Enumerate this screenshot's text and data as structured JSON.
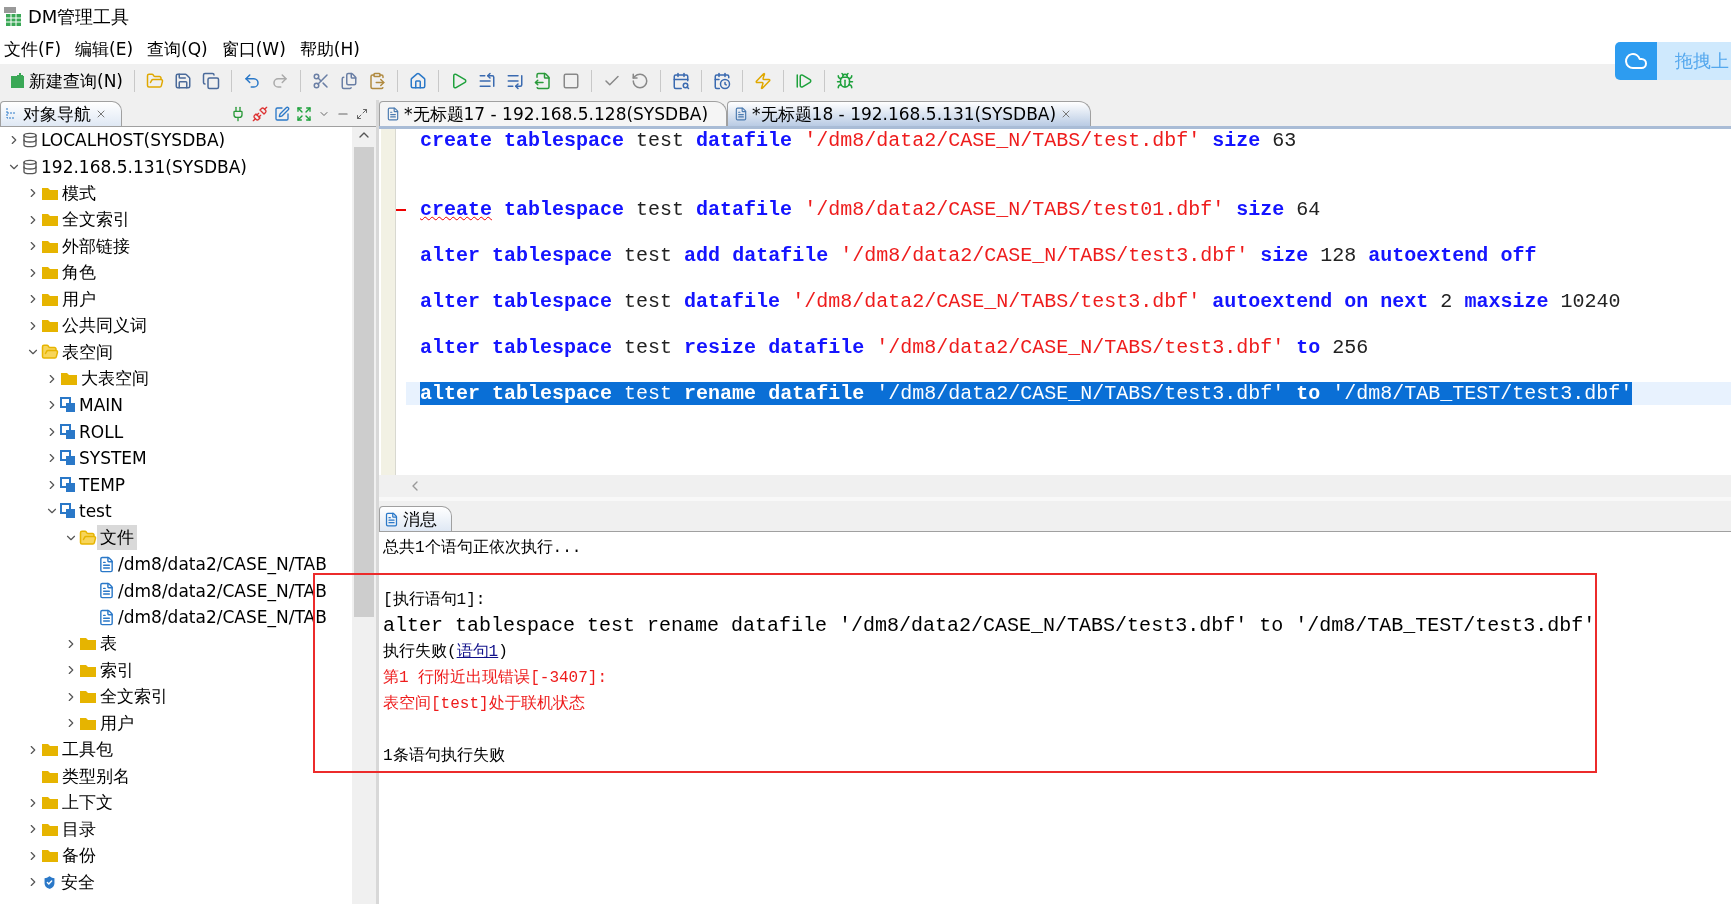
{
  "window": {
    "title": "DM管理工具"
  },
  "menu": [
    "文件(F)",
    "编辑(E)",
    "查询(Q)",
    "窗口(W)",
    "帮助(H)"
  ],
  "toolbar": {
    "new_query": "新建查询(N)"
  },
  "upload_widget": {
    "label": "拖拽上"
  },
  "navigator": {
    "title": "对象导航",
    "tree": [
      {
        "label": "LOCALHOST(SYSDBA)",
        "kind": "server",
        "expanded": false,
        "selected": false
      },
      {
        "label": "192.168.5.131(SYSDBA)",
        "kind": "server",
        "expanded": true,
        "selected": false,
        "children": [
          {
            "label": "模式",
            "kind": "folder",
            "expanded": false,
            "selected": false
          },
          {
            "label": "全文索引",
            "kind": "folder",
            "expanded": false,
            "selected": false
          },
          {
            "label": "外部链接",
            "kind": "folder",
            "expanded": false,
            "selected": false
          },
          {
            "label": "角色",
            "kind": "folder",
            "expanded": false,
            "selected": false
          },
          {
            "label": "用户",
            "kind": "folder",
            "expanded": false,
            "selected": false
          },
          {
            "label": "公共同义词",
            "kind": "folder",
            "expanded": false,
            "selected": false
          },
          {
            "label": "表空间",
            "kind": "folder",
            "expanded": true,
            "selected": false,
            "children": [
              {
                "label": "大表空间",
                "kind": "folder",
                "expanded": false,
                "selected": false
              },
              {
                "label": "MAIN",
                "kind": "tablespace",
                "expanded": false,
                "selected": false
              },
              {
                "label": "ROLL",
                "kind": "tablespace",
                "expanded": false,
                "selected": false
              },
              {
                "label": "SYSTEM",
                "kind": "tablespace",
                "expanded": false,
                "selected": false
              },
              {
                "label": "TEMP",
                "kind": "tablespace",
                "expanded": false,
                "selected": false
              },
              {
                "label": "test",
                "kind": "tablespace",
                "expanded": true,
                "selected": false,
                "children": [
                  {
                    "label": "文件",
                    "kind": "folder",
                    "expanded": true,
                    "selected": true,
                    "children": [
                      {
                        "label": "/dm8/data2/CASE_N/TAB",
                        "kind": "file",
                        "selected": false
                      },
                      {
                        "label": "/dm8/data2/CASE_N/TAB",
                        "kind": "file",
                        "selected": false
                      },
                      {
                        "label": "/dm8/data2/CASE_N/TAB",
                        "kind": "file",
                        "selected": false
                      }
                    ]
                  },
                  {
                    "label": "表",
                    "kind": "folder",
                    "expanded": false,
                    "selected": false
                  },
                  {
                    "label": "索引",
                    "kind": "folder",
                    "expanded": false,
                    "selected": false
                  },
                  {
                    "label": "全文索引",
                    "kind": "folder",
                    "expanded": false,
                    "selected": false
                  },
                  {
                    "label": "用户",
                    "kind": "folder",
                    "expanded": false,
                    "selected": false
                  }
                ]
              }
            ]
          },
          {
            "label": "工具包",
            "kind": "folder",
            "expanded": false,
            "selected": false
          },
          {
            "label": "类型别名",
            "kind": "folder",
            "selected": false
          },
          {
            "label": "上下文",
            "kind": "folder",
            "expanded": false,
            "selected": false
          },
          {
            "label": "目录",
            "kind": "folder",
            "expanded": false,
            "selected": false
          },
          {
            "label": "备份",
            "kind": "folder",
            "expanded": false,
            "selected": false
          },
          {
            "label": "安全",
            "kind": "security",
            "expanded": false,
            "selected": false
          }
        ]
      }
    ]
  },
  "editor_tabs": [
    {
      "label": "*无标题17 - 192.168.5.128(SYSDBA)",
      "selected": false
    },
    {
      "label": "*无标题18 - 192.168.5.131(SYSDBA)",
      "selected": true
    }
  ],
  "editor": {
    "lines": [
      {
        "kind": "code",
        "error": false,
        "selected": false,
        "tokens": [
          {
            "kind": "kw",
            "text": "create"
          },
          {
            "kind": "kw",
            "text": "tablespace"
          },
          {
            "kind": "id",
            "text": "test"
          },
          {
            "kind": "kw",
            "text": "datafile"
          },
          {
            "kind": "str",
            "text": "'/dm8/data2/CASE_N/TABS/test.dbf'"
          },
          {
            "kind": "kw",
            "text": "size"
          },
          {
            "kind": "num",
            "text": "63"
          }
        ]
      },
      {
        "kind": "blank"
      },
      {
        "kind": "blank"
      },
      {
        "kind": "code",
        "error": true,
        "selected": false,
        "tokens": [
          {
            "kind": "kw",
            "text": "create"
          },
          {
            "kind": "kw",
            "text": "tablespace"
          },
          {
            "kind": "id",
            "text": "test"
          },
          {
            "kind": "kw",
            "text": "datafile"
          },
          {
            "kind": "str",
            "text": "'/dm8/data2/CASE_N/TABS/test01.dbf'"
          },
          {
            "kind": "kw",
            "text": "size"
          },
          {
            "kind": "num",
            "text": "64"
          }
        ]
      },
      {
        "kind": "blank"
      },
      {
        "kind": "code",
        "error": false,
        "selected": false,
        "tokens": [
          {
            "kind": "kw",
            "text": "alter"
          },
          {
            "kind": "kw",
            "text": "tablespace"
          },
          {
            "kind": "id",
            "text": "test"
          },
          {
            "kind": "kw",
            "text": "add"
          },
          {
            "kind": "kw",
            "text": "datafile"
          },
          {
            "kind": "str",
            "text": "'/dm8/data2/CASE_N/TABS/test3.dbf'"
          },
          {
            "kind": "kw",
            "text": "size"
          },
          {
            "kind": "num",
            "text": "128"
          },
          {
            "kind": "kw",
            "text": "autoextend"
          },
          {
            "kind": "kw",
            "text": "off"
          }
        ]
      },
      {
        "kind": "blank"
      },
      {
        "kind": "code",
        "error": false,
        "selected": false,
        "tokens": [
          {
            "kind": "kw",
            "text": "alter"
          },
          {
            "kind": "kw",
            "text": "tablespace"
          },
          {
            "kind": "id",
            "text": "test"
          },
          {
            "kind": "kw",
            "text": "datafile"
          },
          {
            "kind": "str",
            "text": "'/dm8/data2/CASE_N/TABS/test3.dbf'"
          },
          {
            "kind": "kw",
            "text": "autoextend"
          },
          {
            "kind": "kw",
            "text": "on"
          },
          {
            "kind": "kw",
            "text": "next"
          },
          {
            "kind": "num",
            "text": "2"
          },
          {
            "kind": "kw",
            "text": "maxsize"
          },
          {
            "kind": "num",
            "text": "10240"
          }
        ]
      },
      {
        "kind": "blank"
      },
      {
        "kind": "code",
        "error": false,
        "selected": false,
        "tokens": [
          {
            "kind": "kw",
            "text": "alter"
          },
          {
            "kind": "kw",
            "text": "tablespace"
          },
          {
            "kind": "id",
            "text": "test"
          },
          {
            "kind": "kw",
            "text": "resize"
          },
          {
            "kind": "kw",
            "text": "datafile"
          },
          {
            "kind": "str",
            "text": "'/dm8/data2/CASE_N/TABS/test3.dbf'"
          },
          {
            "kind": "kw",
            "text": "to"
          },
          {
            "kind": "num",
            "text": "256"
          }
        ]
      },
      {
        "kind": "blank"
      },
      {
        "kind": "code",
        "error": false,
        "selected": true,
        "tokens": [
          {
            "kind": "kw",
            "text": "alter"
          },
          {
            "kind": "kw",
            "text": "tablespace"
          },
          {
            "kind": "id",
            "text": "test"
          },
          {
            "kind": "kw",
            "text": "rename"
          },
          {
            "kind": "kw",
            "text": "datafile"
          },
          {
            "kind": "str",
            "text": "'/dm8/data2/CASE_N/TABS/test3.dbf'"
          },
          {
            "kind": "kw",
            "text": "to"
          },
          {
            "kind": "str",
            "text": "'/dm8/TAB_TEST/test3.dbf'"
          }
        ]
      }
    ]
  },
  "messages": {
    "tab": "消息",
    "lines": [
      {
        "kind": "text",
        "text": "总共1个语句正依次执行..."
      },
      {
        "kind": "blank"
      },
      {
        "kind": "text",
        "text": "[执行语句1]:"
      },
      {
        "kind": "code",
        "text": "alter tablespace test rename datafile '/dm8/data2/CASE_N/TABS/test3.dbf' to '/dm8/TAB_TEST/test3.dbf'"
      },
      {
        "kind": "status",
        "text": "执行失败(",
        "link": "语句1",
        "suffix": ")"
      },
      {
        "kind": "error",
        "text": "第1 行附近出现错误[-3407]:"
      },
      {
        "kind": "error",
        "text": "表空间[test]处于联机状态"
      },
      {
        "kind": "blank"
      },
      {
        "kind": "text",
        "text": "1条语句执行失败"
      }
    ]
  }
}
